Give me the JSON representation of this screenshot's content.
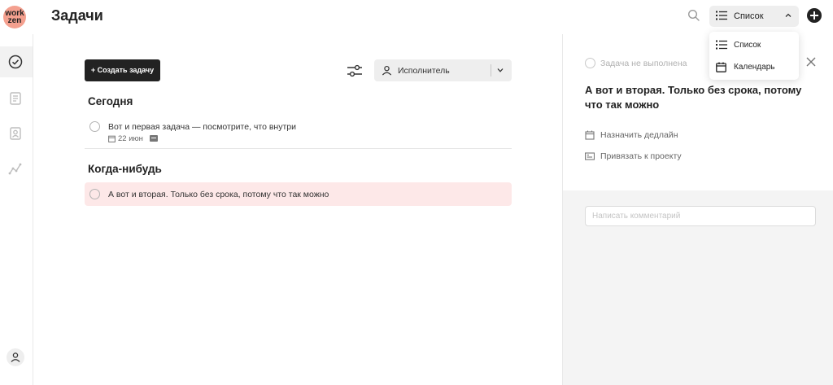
{
  "app": {
    "logo_text_line1": "work",
    "logo_text_line2": "zen",
    "page_title": "Задачи"
  },
  "header": {
    "view_select_label": "Список",
    "icons": [
      "search-icon",
      "list-icon",
      "chevron-up-icon",
      "plus-circle-icon"
    ]
  },
  "view_menu": {
    "items": [
      {
        "label": "Список",
        "icon": "list-icon"
      },
      {
        "label": "Календарь",
        "icon": "calendar-icon"
      }
    ]
  },
  "sidebar": {
    "items": [
      {
        "name": "tasks",
        "icon": "check-circle-icon",
        "active": true
      },
      {
        "name": "documents",
        "icon": "document-icon",
        "active": false
      },
      {
        "name": "contacts",
        "icon": "contact-card-icon",
        "active": false
      },
      {
        "name": "analytics",
        "icon": "chart-line-icon",
        "active": false
      }
    ],
    "user_icon": "user-icon"
  },
  "toolbar": {
    "create_task_label": "+ Создать задачу",
    "assignee_label": "Исполнитель"
  },
  "sections": [
    {
      "heading": "Сегодня",
      "tasks": [
        {
          "title": "Вот и первая задача — посмотрите, что внутри",
          "date": "22 июн",
          "has_note": true
        }
      ]
    },
    {
      "heading": "Когда-нибудь",
      "tasks": [
        {
          "title": "А вот и вторая. Только без срока, потому что так можно",
          "selected": true
        }
      ]
    }
  ],
  "detail_panel": {
    "status": "Задача не выполнена",
    "title": "А вот и вторая. Только без срока, потому что так можно",
    "actions": [
      {
        "label": "Назначить дедлайн",
        "icon": "calendar-icon"
      },
      {
        "label": "Привязать к проекту",
        "icon": "project-card-icon"
      }
    ],
    "comment_placeholder": "Написать комментарий"
  },
  "colors": {
    "accent_dark": "#222222",
    "selected_task_bg": "#fde8e8",
    "logo_bg": "#f4a08f",
    "panel_bg": "#f4f4f4"
  }
}
